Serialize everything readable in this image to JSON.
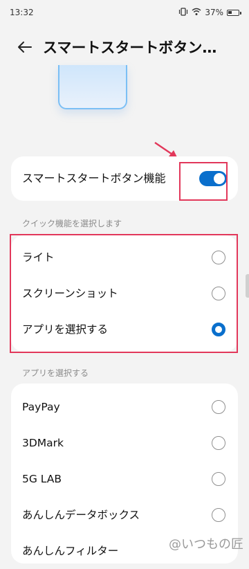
{
  "status_bar": {
    "time": "13:32",
    "battery_percent": "37%",
    "battery_level": 0.37
  },
  "header": {
    "title": "スマートスタートボタンの…",
    "back_icon": "arrow-left-icon"
  },
  "toggle_setting": {
    "label": "スマートスタートボタン機能",
    "enabled": true,
    "accent_color": "#0a6fcc"
  },
  "quick_function": {
    "section_label": "クイック機能を選択します",
    "options": [
      {
        "label": "ライト",
        "selected": false
      },
      {
        "label": "スクリーンショット",
        "selected": false
      },
      {
        "label": "アプリを選択する",
        "selected": true
      }
    ]
  },
  "app_select": {
    "section_label": "アプリを選択する",
    "apps": [
      {
        "label": "PayPay",
        "selected": false
      },
      {
        "label": "3DMark",
        "selected": false
      },
      {
        "label": "5G LAB",
        "selected": false
      },
      {
        "label": "あんしんデータボックス",
        "selected": false
      },
      {
        "label": "あんしんフィルター",
        "selected": false
      }
    ]
  },
  "annotation_color": "#e2375a",
  "watermark": "@いつもの匠"
}
